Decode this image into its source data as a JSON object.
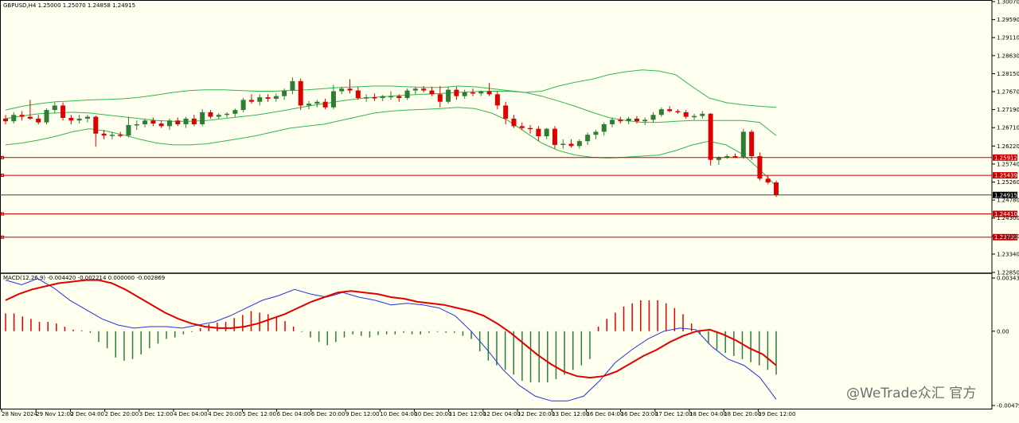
{
  "symbol_header": "GBPUSD,H4  1.25000 1.25070 1.24858 1.24915",
  "macd_header": "MACD(12,26,9) -0.004420 -0.002214 0.000000 -0.002869",
  "watermark": "@WeTrade众汇 官方",
  "colors": {
    "bg": "#fffff0",
    "bull": "#2e7d32",
    "bear": "#e00000",
    "band": "#2fb84a",
    "macd_line": "#e00000",
    "signal_line": "#2233dd",
    "hline": "#cc0000"
  },
  "chart_data": [
    {
      "type": "candlestick",
      "title": "GBPUSD,H4",
      "ohlc_text": "1.25000 1.25070 1.24858 1.24915",
      "ylim": [
        1.2285,
        1.3007
      ],
      "y_tick_labels": [
        "1.30070",
        "1.29590",
        "1.29110",
        "1.28630",
        "1.28150",
        "1.27670",
        "1.27190",
        "1.26710",
        "1.26220",
        "1.25740",
        "1.25260",
        "1.24780",
        "1.24300",
        "1.23820",
        "1.23340",
        "1.22850"
      ],
      "x_tick_labels": [
        "28 Nov 2024",
        "29 Nov 12:00",
        "2 Dec 04:00",
        "2 Dec 20:00",
        "3 Dec 12:00",
        "4 Dec 04:00",
        "4 Dec 20:00",
        "5 Dec 12:00",
        "6 Dec 04:00",
        "6 Dec 20:00",
        "9 Dec 12:00",
        "10 Dec 04:00",
        "10 Dec 20:00",
        "11 Dec 12:00",
        "12 Dec 04:00",
        "12 Dec 20:00",
        "13 Dec 12:00",
        "16 Dec 04:00",
        "16 Dec 20:00",
        "17 Dec 12:00",
        "18 Dec 04:00",
        "18 Dec 20:00",
        "19 Dec 12:00"
      ],
      "current_price": "1.24915",
      "horizontal_lines": [
        "1.25912",
        "1.25439",
        "1.24410",
        "1.23790"
      ],
      "candles": [
        [
          1.2695,
          1.2705,
          1.268,
          1.2688
        ],
        [
          1.2688,
          1.2712,
          1.2682,
          1.2705
        ],
        [
          1.2705,
          1.2715,
          1.269,
          1.27
        ],
        [
          1.27,
          1.2745,
          1.2692,
          1.2695
        ],
        [
          1.2695,
          1.2705,
          1.268,
          1.2685
        ],
        [
          1.2685,
          1.2722,
          1.268,
          1.2718
        ],
        [
          1.2718,
          1.2738,
          1.271,
          1.273
        ],
        [
          1.273,
          1.2738,
          1.269,
          1.2697
        ],
        [
          1.2697,
          1.2705,
          1.268,
          1.269
        ],
        [
          1.269,
          1.2705,
          1.2682,
          1.2695
        ],
        [
          1.2695,
          1.2705,
          1.2685,
          1.27
        ],
        [
          1.27,
          1.2703,
          1.262,
          1.2655
        ],
        [
          1.2655,
          1.2665,
          1.264,
          1.265
        ],
        [
          1.265,
          1.266,
          1.264,
          1.2652
        ],
        [
          1.2652,
          1.266,
          1.2645,
          1.265
        ],
        [
          1.265,
          1.27,
          1.2645,
          1.2678
        ],
        [
          1.2678,
          1.269,
          1.2665,
          1.268
        ],
        [
          1.268,
          1.2695,
          1.2672,
          1.269
        ],
        [
          1.269,
          1.2698,
          1.2675,
          1.2682
        ],
        [
          1.2682,
          1.269,
          1.267,
          1.2675
        ],
        [
          1.2675,
          1.2695,
          1.2665,
          1.269
        ],
        [
          1.269,
          1.2698,
          1.2675,
          1.268
        ],
        [
          1.268,
          1.27,
          1.267,
          1.2695
        ],
        [
          1.2695,
          1.2705,
          1.2675,
          1.268
        ],
        [
          1.268,
          1.272,
          1.2675,
          1.2712
        ],
        [
          1.2712,
          1.2718,
          1.2695,
          1.27
        ],
        [
          1.27,
          1.271,
          1.2695,
          1.2705
        ],
        [
          1.2705,
          1.2712,
          1.2698,
          1.2708
        ],
        [
          1.2708,
          1.2722,
          1.27,
          1.2718
        ],
        [
          1.2718,
          1.275,
          1.2712,
          1.2745
        ],
        [
          1.2745,
          1.276,
          1.2735,
          1.274
        ],
        [
          1.274,
          1.276,
          1.273,
          1.2752
        ],
        [
          1.2752,
          1.276,
          1.274,
          1.2748
        ],
        [
          1.2748,
          1.2762,
          1.274,
          1.2755
        ],
        [
          1.2755,
          1.2775,
          1.2745,
          1.277
        ],
        [
          1.277,
          1.2805,
          1.276,
          1.2795
        ],
        [
          1.2795,
          1.2802,
          1.2718,
          1.273
        ],
        [
          1.273,
          1.2742,
          1.272,
          1.2735
        ],
        [
          1.2735,
          1.2745,
          1.2725,
          1.274
        ],
        [
          1.274,
          1.2748,
          1.272,
          1.2725
        ],
        [
          1.2725,
          1.2785,
          1.272,
          1.2768
        ],
        [
          1.2768,
          1.278,
          1.276,
          1.2775
        ],
        [
          1.2775,
          1.28,
          1.2762,
          1.277
        ],
        [
          1.277,
          1.278,
          1.2745,
          1.275
        ],
        [
          1.275,
          1.276,
          1.274,
          1.2752
        ],
        [
          1.2752,
          1.2762,
          1.2742,
          1.275
        ],
        [
          1.275,
          1.2758,
          1.2742,
          1.2755
        ],
        [
          1.2755,
          1.2768,
          1.2745,
          1.2755
        ],
        [
          1.2755,
          1.276,
          1.274,
          1.275
        ],
        [
          1.275,
          1.2775,
          1.2745,
          1.277
        ],
        [
          1.277,
          1.278,
          1.276,
          1.2775
        ],
        [
          1.2775,
          1.2782,
          1.2765,
          1.277
        ],
        [
          1.277,
          1.278,
          1.2755,
          1.276
        ],
        [
          1.276,
          1.2782,
          1.2725,
          1.274
        ],
        [
          1.274,
          1.278,
          1.2735,
          1.2772
        ],
        [
          1.2772,
          1.278,
          1.2745,
          1.2755
        ],
        [
          1.2755,
          1.2772,
          1.2748,
          1.2765
        ],
        [
          1.2765,
          1.2775,
          1.2755,
          1.2762
        ],
        [
          1.2762,
          1.277,
          1.2755,
          1.2768
        ],
        [
          1.2768,
          1.279,
          1.2755,
          1.276
        ],
        [
          1.276,
          1.2768,
          1.272,
          1.273
        ],
        [
          1.273,
          1.274,
          1.268,
          1.2695
        ],
        [
          1.2695,
          1.2705,
          1.267,
          1.2675
        ],
        [
          1.2675,
          1.2685,
          1.2665,
          1.267
        ],
        [
          1.267,
          1.2678,
          1.2655,
          1.2668
        ],
        [
          1.2668,
          1.2675,
          1.2635,
          1.2648
        ],
        [
          1.2648,
          1.267,
          1.264,
          1.2668
        ],
        [
          1.2668,
          1.2675,
          1.2615,
          1.2625
        ],
        [
          1.2625,
          1.264,
          1.2615,
          1.2628
        ],
        [
          1.2628,
          1.264,
          1.2618,
          1.2622
        ],
        [
          1.2622,
          1.264,
          1.2615,
          1.2635
        ],
        [
          1.2635,
          1.2658,
          1.2625,
          1.2652
        ],
        [
          1.2652,
          1.2665,
          1.264,
          1.266
        ],
        [
          1.266,
          1.2685,
          1.265,
          1.268
        ],
        [
          1.268,
          1.2698,
          1.2672,
          1.2692
        ],
        [
          1.2692,
          1.27,
          1.2682,
          1.2688
        ],
        [
          1.2688,
          1.27,
          1.268,
          1.2695
        ],
        [
          1.2695,
          1.2702,
          1.2682,
          1.2688
        ],
        [
          1.2688,
          1.2698,
          1.2678,
          1.2692
        ],
        [
          1.2692,
          1.2712,
          1.2685,
          1.2705
        ],
        [
          1.2705,
          1.2725,
          1.27,
          1.272
        ],
        [
          1.272,
          1.2728,
          1.2712,
          1.2715
        ],
        [
          1.2715,
          1.272,
          1.2708,
          1.2712
        ],
        [
          1.2712,
          1.2718,
          1.2695,
          1.27
        ],
        [
          1.27,
          1.2708,
          1.2692,
          1.2702
        ],
        [
          1.2702,
          1.2715,
          1.2695,
          1.2708
        ],
        [
          1.2708,
          1.271,
          1.257,
          1.2585
        ],
        [
          1.2585,
          1.2595,
          1.2572,
          1.2592
        ],
        [
          1.2592,
          1.26,
          1.2588,
          1.2595
        ],
        [
          1.2595,
          1.2602,
          1.259,
          1.2593
        ],
        [
          1.2593,
          1.2668,
          1.2588,
          1.266
        ],
        [
          1.266,
          1.2665,
          1.2585,
          1.2595
        ],
        [
          1.2595,
          1.2605,
          1.253,
          1.2535
        ],
        [
          1.2535,
          1.2545,
          1.252,
          1.2525
        ],
        [
          1.2525,
          1.253,
          1.2486,
          1.2492
        ]
      ],
      "bollinger_upper": [
        1.2718,
        1.2728,
        1.2735,
        1.274,
        1.2742,
        1.2745,
        1.2746,
        1.2748,
        1.2752,
        1.2758,
        1.2765,
        1.277,
        1.2772,
        1.2772,
        1.277,
        1.2768,
        1.2768,
        1.277,
        1.2772,
        1.2775,
        1.2778,
        1.278,
        1.2782,
        1.2782,
        1.278,
        1.2778,
        1.2778,
        1.2782,
        1.278,
        1.2775,
        1.277,
        1.2765,
        1.2768,
        1.2782,
        1.2792,
        1.28,
        1.2812,
        1.282,
        1.2825,
        1.2822,
        1.2812,
        1.278,
        1.275,
        1.2738,
        1.2732,
        1.2728,
        1.2725
      ],
      "bollinger_middle": [
        1.2695,
        1.2702,
        1.2708,
        1.271,
        1.2712,
        1.271,
        1.2705,
        1.27,
        1.2695,
        1.269,
        1.2688,
        1.2688,
        1.269,
        1.2695,
        1.27,
        1.2705,
        1.2712,
        1.272,
        1.2728,
        1.2735,
        1.2742,
        1.2748,
        1.2752,
        1.2755,
        1.2758,
        1.276,
        1.2762,
        1.2765,
        1.2767,
        1.2768,
        1.2768,
        1.2765,
        1.2755,
        1.2742,
        1.2728,
        1.2712,
        1.2698,
        1.269,
        1.2685,
        1.2685,
        1.2688,
        1.269,
        1.269,
        1.269,
        1.269,
        1.2685,
        1.265
      ],
      "bollinger_lower": [
        1.2625,
        1.263,
        1.2638,
        1.2648,
        1.266,
        1.2668,
        1.2662,
        1.2652,
        1.264,
        1.263,
        1.2625,
        1.2625,
        1.2628,
        1.2635,
        1.2642,
        1.265,
        1.266,
        1.267,
        1.2675,
        1.268,
        1.269,
        1.27,
        1.271,
        1.2715,
        1.2718,
        1.272,
        1.2722,
        1.2725,
        1.2722,
        1.271,
        1.269,
        1.266,
        1.263,
        1.261,
        1.2598,
        1.2592,
        1.259,
        1.2592,
        1.2595,
        1.2598,
        1.261,
        1.2625,
        1.2635,
        1.2625,
        1.26,
        1.256,
        1.2515
      ]
    },
    {
      "type": "histogram+line",
      "title": "MACD(12,26,9)",
      "values_text": "-0.004420 -0.002214 0.000000 -0.002869",
      "ylim": [
        -0.004795,
        0.003436
      ],
      "y_tick_labels": [
        "0.003436",
        "0.00",
        "-0.004795"
      ],
      "histogram": [
        0.00115,
        0.00115,
        0.00095,
        0.0008,
        0.0006,
        0.0006,
        0.0005,
        0.0003,
        0.0001,
        5e-05,
        -0.0001,
        -0.0007,
        -0.0011,
        -0.0017,
        -0.0019,
        -0.0018,
        -0.0015,
        -0.0011,
        -0.0008,
        -0.0005,
        -0.0004,
        -0.0002,
        -5e-05,
        0.0002,
        0.00045,
        0.00055,
        0.0006,
        0.00085,
        0.00105,
        0.0013,
        0.0012,
        0.0011,
        0.0009,
        0.00065,
        0.0003,
        -5e-05,
        -0.0004,
        -0.0007,
        -0.0009,
        -0.0007,
        -0.0004,
        -0.0002,
        -0.0003,
        -0.0004,
        -0.00025,
        -0.0002,
        -0.0002,
        -0.0001,
        -0.0002,
        -0.0002,
        -0.0001,
        -5e-05,
        -0.0001,
        -0.0001,
        -0.0003,
        -0.0005,
        -0.0013,
        -0.0019,
        -0.0022,
        -0.0025,
        -0.0028,
        -0.0032,
        -0.0033,
        -0.0033,
        -0.0033,
        -0.0031,
        -0.0028,
        -0.0025,
        -0.0022,
        -0.0018,
        0.0003,
        0.0008,
        0.0012,
        0.0016,
        0.0018,
        0.002,
        0.002,
        0.002,
        0.0018,
        0.0015,
        0.0011,
        0.0005,
        -0.0002,
        -0.0008,
        -0.0012,
        -0.0014,
        -0.0016,
        -0.0018,
        -0.002,
        -0.0022,
        -0.0025,
        -0.0028
      ],
      "macd_line": [
        0.002,
        0.0024,
        0.0027,
        0.0029,
        0.0031,
        0.0032,
        0.0033,
        0.0033,
        0.0031,
        0.0027,
        0.0022,
        0.0017,
        0.0012,
        0.0008,
        0.0005,
        0.0003,
        0.0002,
        0.0002,
        0.0003,
        0.0005,
        0.0008,
        0.0011,
        0.0015,
        0.0019,
        0.0022,
        0.0025,
        0.0026,
        0.0025,
        0.0024,
        0.0022,
        0.0021,
        0.0019,
        0.0018,
        0.0017,
        0.0015,
        0.0013,
        0.001,
        0.0005,
        -0.0001,
        -0.0008,
        -0.0015,
        -0.0021,
        -0.0026,
        -0.0029,
        -0.003,
        -0.0029,
        -0.0026,
        -0.0021,
        -0.0016,
        -0.0012,
        -0.0007,
        -0.0003,
        0.0,
        0.0001,
        -0.0002,
        -0.0006,
        -0.0011,
        -0.0015,
        -0.0022
      ],
      "signal_line": [
        0.0033,
        0.003,
        0.0034,
        0.0028,
        0.002,
        0.0014,
        0.0008,
        0.0004,
        0.0002,
        0.0003,
        0.0003,
        0.0002,
        0.0004,
        0.0006,
        0.001,
        0.0015,
        0.002,
        0.0023,
        0.0027,
        0.0024,
        0.0022,
        0.0025,
        0.0022,
        0.002,
        0.0017,
        0.0018,
        0.0017,
        0.0015,
        0.001,
        0.0,
        -0.0012,
        -0.0025,
        -0.0035,
        -0.0042,
        -0.0045,
        -0.0045,
        -0.0042,
        -0.0032,
        -0.002,
        -0.0012,
        -0.0005,
        0.0,
        0.0002,
        0.0001,
        -0.001,
        -0.0018,
        -0.0022,
        -0.003,
        -0.0044
      ]
    }
  ]
}
